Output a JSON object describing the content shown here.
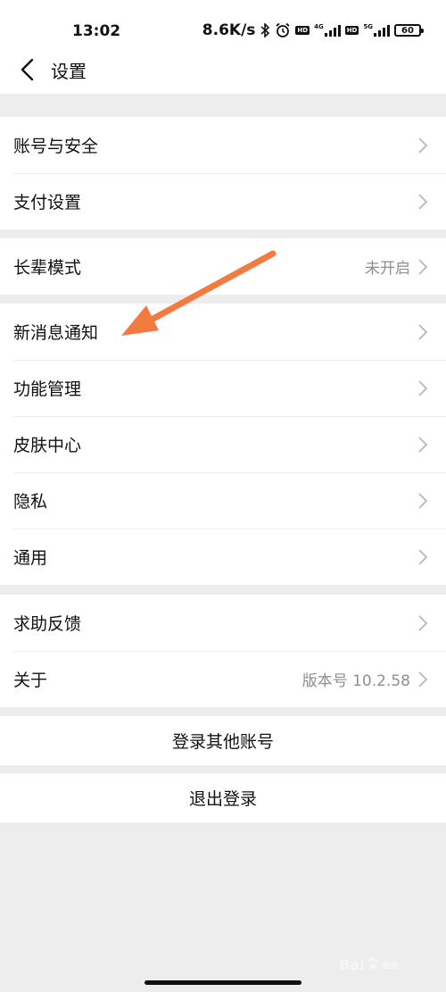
{
  "status_bar": {
    "time": "13:02",
    "net_speed": "8.6K/s",
    "network_label_1": "4G",
    "network_label_2": "5G",
    "hd_label": "HD",
    "battery": "60"
  },
  "header": {
    "title": "设置"
  },
  "groups": [
    {
      "items": [
        {
          "label": "账号与安全"
        },
        {
          "label": "支付设置"
        }
      ]
    },
    {
      "items": [
        {
          "label": "长辈模式",
          "value": "未开启"
        }
      ]
    },
    {
      "items": [
        {
          "label": "新消息通知"
        },
        {
          "label": "功能管理"
        },
        {
          "label": "皮肤中心"
        },
        {
          "label": "隐私"
        },
        {
          "label": "通用"
        }
      ]
    },
    {
      "items": [
        {
          "label": "求助反馈"
        },
        {
          "label": "关于",
          "value": "版本号 10.2.58"
        }
      ]
    }
  ],
  "actions": {
    "switch_account": "登录其他账号",
    "logout": "退出登录"
  },
  "watermark": {
    "brand": "Bai",
    "sub": "经验"
  },
  "colors": {
    "background": "#ededed",
    "annotation_arrow": "#f47b40",
    "secondary_text": "#8e8e8e"
  }
}
